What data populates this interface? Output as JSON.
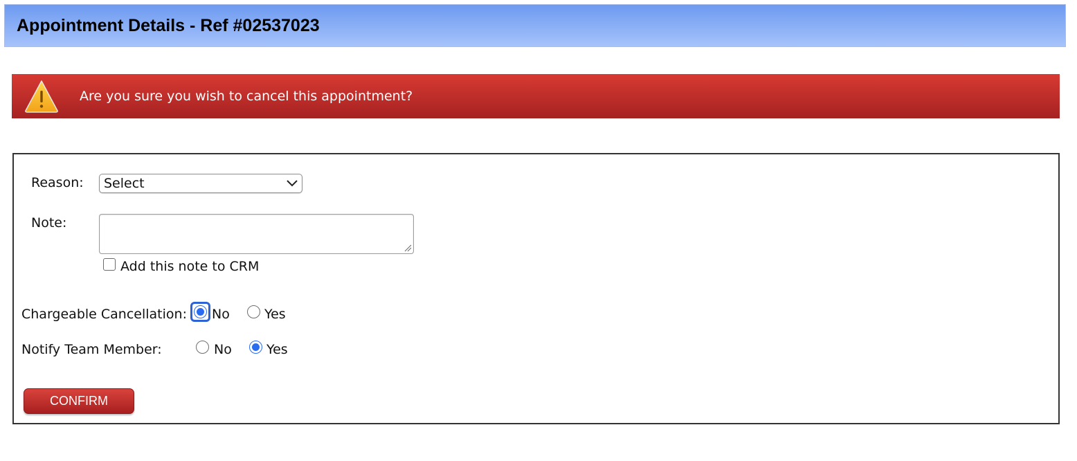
{
  "header": {
    "title": "Appointment Details - Ref #02537023"
  },
  "alert": {
    "icon": "warning-icon",
    "message": "Are you sure you wish to cancel this appointment?"
  },
  "form": {
    "reason": {
      "label": "Reason:",
      "selected": "Select"
    },
    "note": {
      "label": "Note:",
      "value": "",
      "crm_checkbox_label": "Add this note to CRM",
      "crm_checked": false
    },
    "chargeable": {
      "label": "Chargeable Cancellation:",
      "options": [
        {
          "label": "No",
          "checked": true
        },
        {
          "label": "Yes",
          "checked": false
        }
      ]
    },
    "notify": {
      "label": "Notify Team Member:",
      "options": [
        {
          "label": "No",
          "checked": false
        },
        {
          "label": "Yes",
          "checked": true
        }
      ]
    },
    "confirm_label": "CONFIRM"
  },
  "colors": {
    "header_gradient_top": "#6d9af0",
    "header_gradient_bottom": "#a6c3fb",
    "alert_red": "#c62f2c",
    "button_red": "#b52a27",
    "radio_accent": "#2a6cf0"
  }
}
